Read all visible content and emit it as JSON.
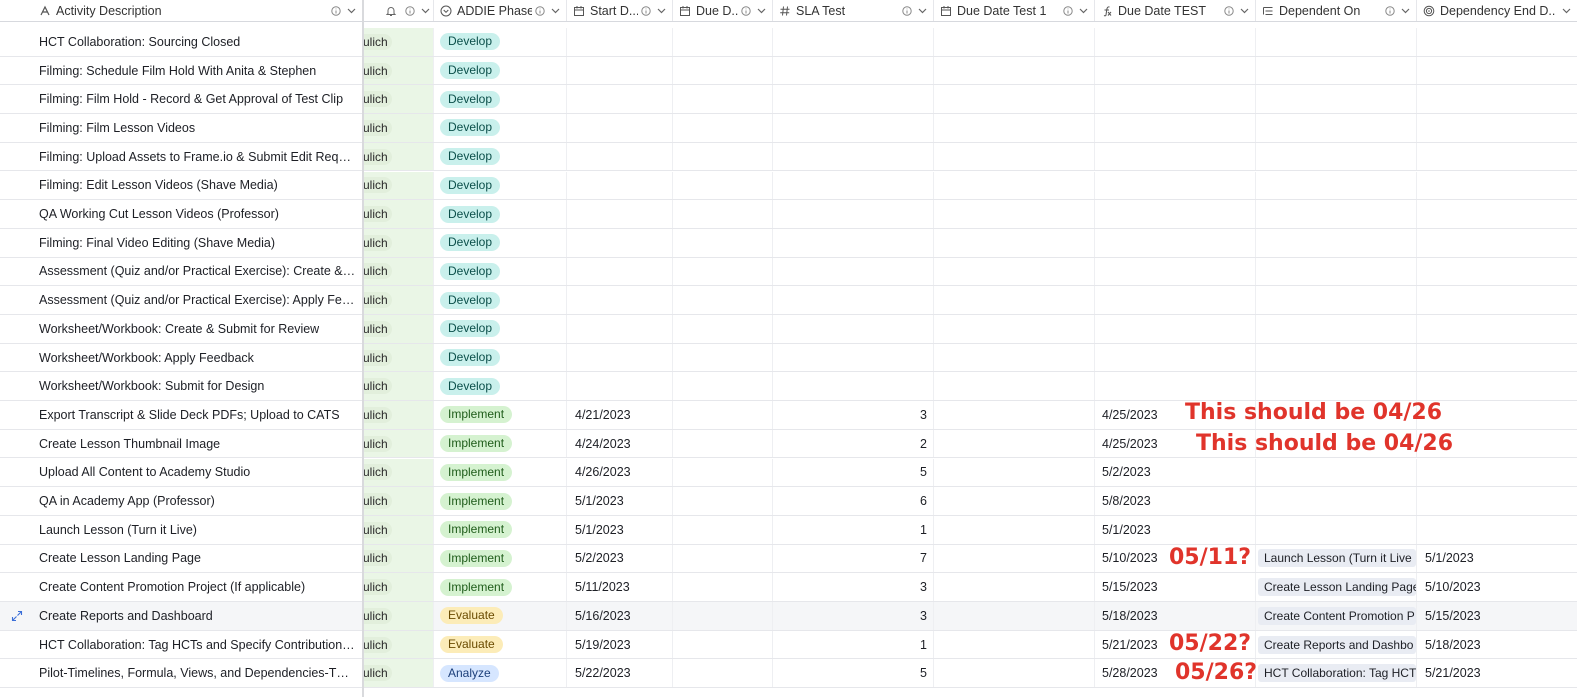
{
  "columns": [
    {
      "label": "Activity Description",
      "icon": "text-field-icon"
    },
    {
      "label": "",
      "icon": "bell-icon"
    },
    {
      "label": "ADDIE Phase",
      "icon": "single-select-icon"
    },
    {
      "label": "Start D...",
      "icon": "calendar-icon"
    },
    {
      "label": "Due D...",
      "icon": "calendar-icon"
    },
    {
      "label": "SLA Test",
      "icon": "hash-icon"
    },
    {
      "label": "Due Date Test 1",
      "icon": "calendar-icon"
    },
    {
      "label": "Due Date TEST",
      "icon": "formula-icon"
    },
    {
      "label": "Dependent On",
      "icon": "link-icon"
    },
    {
      "label": "Dependency End D...",
      "icon": "lookup-icon"
    }
  ],
  "phase_colors": {
    "Develop": {
      "bg": "#c9f0ec",
      "fg": "#0b4f4a"
    },
    "Implement": {
      "bg": "#d5f2d0",
      "fg": "#1f5c1a"
    },
    "Evaluate": {
      "bg": "#fcecb8",
      "fg": "#6a4b00"
    },
    "Analyze": {
      "bg": "#d6e6ff",
      "fg": "#1c3f7a"
    }
  },
  "rows": [
    {
      "desc": "HCT Collaboration: Sourcing Closed",
      "owner": "ulich",
      "phase": "Develop",
      "start": "",
      "sla": "",
      "due_test": "",
      "dep": "",
      "dep_end": ""
    },
    {
      "desc": "Filming: Schedule Film Hold With Anita & Stephen",
      "owner": "ulich",
      "phase": "Develop",
      "start": "",
      "sla": "",
      "due_test": "",
      "dep": "",
      "dep_end": ""
    },
    {
      "desc": "Filming: Film Hold - Record & Get Approval of Test Clip",
      "owner": "ulich",
      "phase": "Develop",
      "start": "",
      "sla": "",
      "due_test": "",
      "dep": "",
      "dep_end": ""
    },
    {
      "desc": "Filming: Film Lesson Videos",
      "owner": "ulich",
      "phase": "Develop",
      "start": "",
      "sla": "",
      "due_test": "",
      "dep": "",
      "dep_end": ""
    },
    {
      "desc": "Filming: Upload Assets to Frame.io & Submit Edit Reques...",
      "owner": "ulich",
      "phase": "Develop",
      "start": "",
      "sla": "",
      "due_test": "",
      "dep": "",
      "dep_end": ""
    },
    {
      "desc": "Filming: Edit Lesson Videos (Shave Media)",
      "owner": "ulich",
      "phase": "Develop",
      "start": "",
      "sla": "",
      "due_test": "",
      "dep": "",
      "dep_end": ""
    },
    {
      "desc": "QA Working Cut Lesson Videos (Professor)",
      "owner": "ulich",
      "phase": "Develop",
      "start": "",
      "sla": "",
      "due_test": "",
      "dep": "",
      "dep_end": ""
    },
    {
      "desc": "Filming: Final Video Editing (Shave Media)",
      "owner": "ulich",
      "phase": "Develop",
      "start": "",
      "sla": "",
      "due_test": "",
      "dep": "",
      "dep_end": ""
    },
    {
      "desc": "Assessment (Quiz and/or Practical Exercise): Create & S...",
      "owner": "ulich",
      "phase": "Develop",
      "start": "",
      "sla": "",
      "due_test": "",
      "dep": "",
      "dep_end": ""
    },
    {
      "desc": "Assessment (Quiz and/or Practical Exercise): Apply Feed...",
      "owner": "ulich",
      "phase": "Develop",
      "start": "",
      "sla": "",
      "due_test": "",
      "dep": "",
      "dep_end": ""
    },
    {
      "desc": "Worksheet/Workbook: Create & Submit for Review",
      "owner": "ulich",
      "phase": "Develop",
      "start": "",
      "sla": "",
      "due_test": "",
      "dep": "",
      "dep_end": ""
    },
    {
      "desc": "Worksheet/Workbook: Apply Feedback",
      "owner": "ulich",
      "phase": "Develop",
      "start": "",
      "sla": "",
      "due_test": "",
      "dep": "",
      "dep_end": ""
    },
    {
      "desc": "Worksheet/Workbook: Submit for Design",
      "owner": "ulich",
      "phase": "Develop",
      "start": "",
      "sla": "",
      "due_test": "",
      "dep": "",
      "dep_end": ""
    },
    {
      "desc": "Export Transcript & Slide Deck PDFs; Upload to CATS",
      "owner": "ulich",
      "phase": "Implement",
      "start": "4/21/2023",
      "sla": "3",
      "due_test": "4/25/2023",
      "dep": "",
      "dep_end": ""
    },
    {
      "desc": "Create Lesson Thumbnail Image",
      "owner": "ulich",
      "phase": "Implement",
      "start": "4/24/2023",
      "sla": "2",
      "due_test": "4/25/2023",
      "dep": "",
      "dep_end": ""
    },
    {
      "desc": "Upload All Content to Academy Studio",
      "owner": "ulich",
      "phase": "Implement",
      "start": "4/26/2023",
      "sla": "5",
      "due_test": "5/2/2023",
      "dep": "",
      "dep_end": ""
    },
    {
      "desc": "QA in Academy App (Professor)",
      "owner": "ulich",
      "phase": "Implement",
      "start": "5/1/2023",
      "sla": "6",
      "due_test": "5/8/2023",
      "dep": "",
      "dep_end": ""
    },
    {
      "desc": "Launch Lesson (Turn it Live)",
      "owner": "ulich",
      "phase": "Implement",
      "start": "5/1/2023",
      "sla": "1",
      "due_test": "5/1/2023",
      "dep": "",
      "dep_end": ""
    },
    {
      "desc": "Create Lesson Landing Page",
      "owner": "ulich",
      "phase": "Implement",
      "start": "5/2/2023",
      "sla": "7",
      "due_test": "5/10/2023",
      "dep": "Launch Lesson (Turn it Live",
      "dep_end": "5/1/2023"
    },
    {
      "desc": "Create Content Promotion Project (If applicable)",
      "owner": "ulich",
      "phase": "Implement",
      "start": "5/11/2023",
      "sla": "3",
      "due_test": "5/15/2023",
      "dep": "Create Lesson Landing Page",
      "dep_end": "5/10/2023"
    },
    {
      "desc": "Create Reports and Dashboard",
      "owner": "ulich",
      "phase": "Evaluate",
      "start": "5/16/2023",
      "sla": "3",
      "due_test": "5/18/2023",
      "dep": "Create Content Promotion P",
      "dep_end": "5/15/2023"
    },
    {
      "desc": "HCT Collaboration: Tag HCTs and Specify Contributions i...",
      "owner": "ulich",
      "phase": "Evaluate",
      "start": "5/19/2023",
      "sla": "1",
      "due_test": "5/21/2023",
      "dep": "Create Reports and Dashbo",
      "dep_end": "5/18/2023"
    },
    {
      "desc": "Pilot-Timelines, Formula, Views, and Dependencies-TEST",
      "owner": "ulich",
      "phase": "Analyze",
      "start": "5/22/2023",
      "sla": "5",
      "due_test": "5/28/2023",
      "dep": "HCT Collaboration: Tag HCT",
      "dep_end": "5/21/2023"
    }
  ],
  "annotations": [
    {
      "text": "This should be 04/26"
    },
    {
      "text": "This should be 04/26"
    },
    {
      "text": "05/11?"
    },
    {
      "text": "05/22?"
    },
    {
      "text": "05/26?"
    }
  ]
}
